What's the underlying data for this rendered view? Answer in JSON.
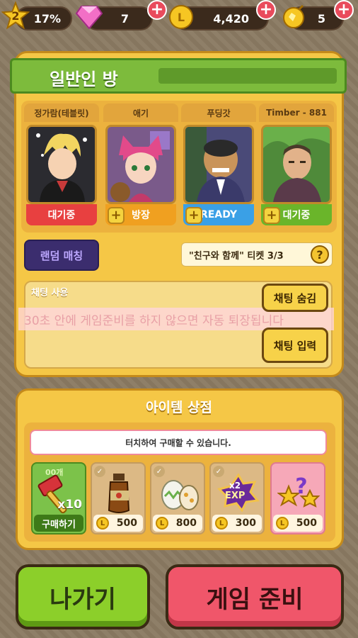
{
  "topbar": {
    "level": "2",
    "level_percent": "17%",
    "gems": "7",
    "coins": "4,420",
    "hearts": "5"
  },
  "room": {
    "title": "일반인 방",
    "players": [
      {
        "name": "정가람(테블릿)",
        "status": "대기중",
        "status_color": "#e84040",
        "has_plus": false
      },
      {
        "name": "애기",
        "status": "방장",
        "status_color": "#f0a020",
        "has_plus": true
      },
      {
        "name": "푸딩갓",
        "status": "READY",
        "status_color": "#3aa0e6",
        "has_plus": true
      },
      {
        "name": "Timber - 881",
        "status": "대기중",
        "status_color": "#6ab52a",
        "has_plus": true
      }
    ],
    "random_match_label": "랜덤 매칭",
    "ticket_text": "\"친구와 함께\" 티켓 3/3",
    "chat": {
      "label": "채팅 사용",
      "notice": "30초 안에 게임준비를 하지 않으면 자동 퇴장됩니다",
      "hide_button": "채팅 숨김",
      "input_button": "채팅 입력"
    }
  },
  "shop": {
    "title": "아이템 상점",
    "notice": "터치하여 구매할 수 있습니다.",
    "items": [
      {
        "name": "hammer",
        "count_label": "00개",
        "multiplier": "x10",
        "action": "구매하기"
      },
      {
        "name": "potion",
        "price": "500"
      },
      {
        "name": "eggs",
        "price": "800"
      },
      {
        "name": "exp-boost",
        "badge": "x2",
        "badge2": "EXP",
        "price": "300"
      },
      {
        "name": "mystery-stars",
        "price": "500"
      }
    ]
  },
  "buttons": {
    "exit": "나가기",
    "ready": "게임 준비"
  },
  "colors": {
    "panel": "#f5c746",
    "ribbon": "#7dbb3c",
    "exit_button": "#8ccf2a",
    "ready_button": "#f0566a"
  }
}
